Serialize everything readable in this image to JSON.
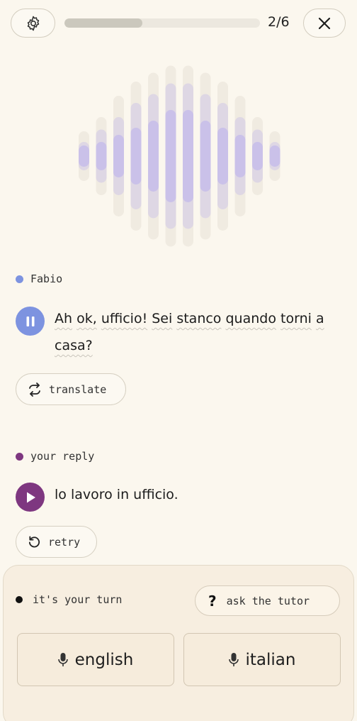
{
  "header": {
    "progress_label": "2/6",
    "progress_fraction": 0.4,
    "settings_icon": "gear-icon",
    "close_icon": "close-icon"
  },
  "tutor": {
    "name": "Fabio",
    "dot_color": "#7d93e0",
    "message_words": [
      "Ah",
      "ok,",
      "ufficio!",
      "Sei",
      "stanco",
      "quando",
      "torni",
      "a",
      "casa?"
    ],
    "play_state": "pause",
    "button_color": "#7d93e0",
    "translate_label": "translate"
  },
  "reply": {
    "label": "your reply",
    "dot_color": "#7e3780",
    "message": "lo lavoro in ufficio.",
    "button_color": "#7e3780",
    "retry_label": "retry"
  },
  "footer": {
    "status": "it's your turn",
    "ask_label": "ask the tutor",
    "english_label": "english",
    "italian_label": "italian"
  },
  "colors": {
    "background": "#fbf7ee",
    "panel": "#f7eee0",
    "wave": "#bdb3ec"
  }
}
